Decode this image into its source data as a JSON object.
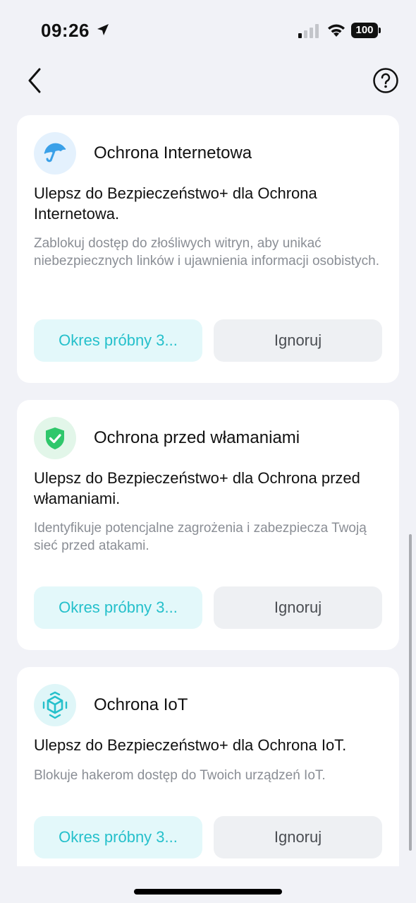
{
  "status_bar": {
    "time": "09:26",
    "battery": "100",
    "icons": [
      "location-arrow-icon",
      "cellular-signal-icon",
      "wifi-icon",
      "battery-icon"
    ]
  },
  "nav": {
    "back_icon": "chevron-left-icon",
    "help_icon": "question-circle-icon"
  },
  "colors": {
    "accent": "#25c0cb",
    "trial_bg": "#e3f8fa",
    "ignore_bg": "#eef0f3",
    "shield_green": "#2fc76b",
    "umbrella_blue": "#3aa0e8"
  },
  "cards": [
    {
      "icon": "umbrella-icon",
      "title": "Ochrona Internetowa",
      "headline": "Ulepsz do Bezpieczeństwo+ dla Ochrona Internetowa.",
      "description": "Zablokuj dostęp do złośliwych witryn, aby unikać niebezpiecznych linków i ujawnienia informacji osobistych.",
      "trial_label": "Okres próbny 3...",
      "ignore_label": "Ignoruj"
    },
    {
      "icon": "shield-check-icon",
      "title": "Ochrona przed włamaniami",
      "headline": "Ulepsz do Bezpieczeństwo+ dla Ochrona przed włamaniami.",
      "description": "Identyfikuje potencjalne zagrożenia i zabezpiecza Twoją sieć przed atakami.",
      "trial_label": "Okres próbny 3...",
      "ignore_label": "Ignoruj"
    },
    {
      "icon": "iot-cube-icon",
      "title": "Ochrona IoT",
      "headline": "Ulepsz do Bezpieczeństwo+ dla Ochrona IoT.",
      "description": "Blokuje hakerom dostęp do Twoich urządzeń IoT.",
      "trial_label": "Okres próbny 3...",
      "ignore_label": "Ignoruj"
    }
  ]
}
